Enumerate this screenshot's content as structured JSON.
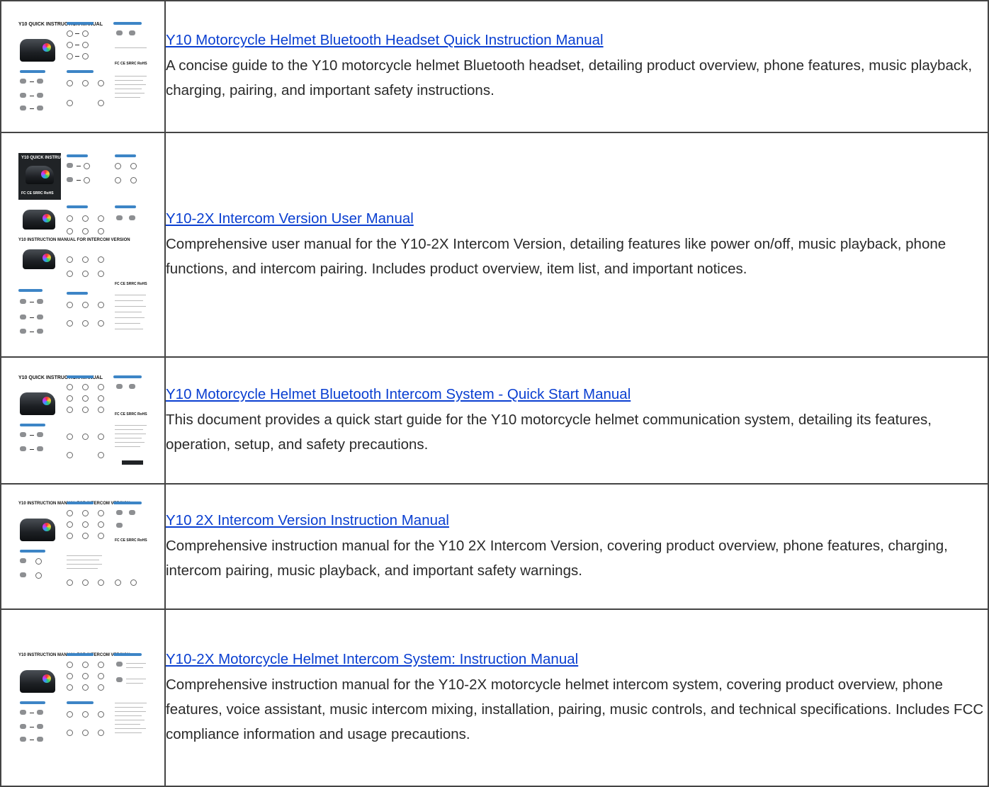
{
  "rows": [
    {
      "thumbnail": "manual-thumbnail",
      "title": "Y10 Motorcycle Helmet Bluetooth Headset Quick Instruction Manual",
      "description": "A concise guide to the Y10 motorcycle helmet Bluetooth headset, detailing product overview, phone features, music playback, charging, pairing, and important safety instructions."
    },
    {
      "thumbnail": "manual-thumbnail",
      "title": "Y10-2X Intercom Version User Manual",
      "description": "Comprehensive user manual for the Y10-2X Intercom Version, detailing features like power on/off, music playback, phone functions, and intercom pairing. Includes product overview, item list, and important notices."
    },
    {
      "thumbnail": "manual-thumbnail",
      "title": "Y10 Motorcycle Helmet Bluetooth Intercom System - Quick Start Manual",
      "description": "This document provides a quick start guide for the Y10 motorcycle helmet communication system, detailing its features, operation, setup, and safety precautions."
    },
    {
      "thumbnail": "manual-thumbnail",
      "title": "Y10 2X Intercom Version Instruction Manual",
      "description": "Comprehensive instruction manual for the Y10 2X Intercom Version, covering product overview, phone features, charging, intercom pairing, music playback, and important safety warnings."
    },
    {
      "thumbnail": "manual-thumbnail",
      "title": "Y10-2X Motorcycle Helmet Intercom System: Instruction Manual",
      "description": "Comprehensive instruction manual for the Y10-2X motorcycle helmet intercom system, covering product overview, phone features, voice assistant, music intercom mixing, installation, pairing, music controls, and technical specifications. Includes FCC compliance information and usage precautions."
    }
  ],
  "thumb_text": {
    "qim": "Y10 QUICK INSTRUCTION MANUAL",
    "im": "Y10 INSTRUCTION MANUAL FOR INTERCOM VERSION",
    "ce": "FC CE SRRC RoHS"
  },
  "colors": {
    "link": "#0a3fd1",
    "border": "#444444",
    "accent_tab": "#3d85c6"
  }
}
